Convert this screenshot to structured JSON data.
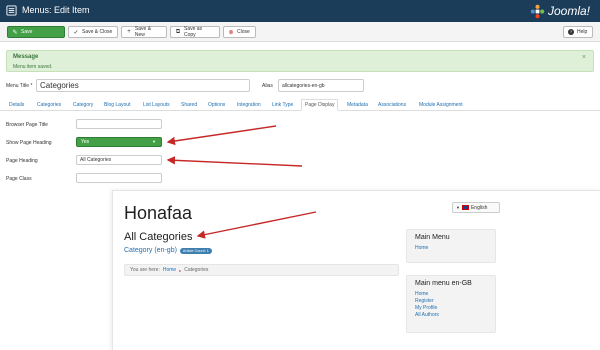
{
  "header": {
    "title": "Menus: Edit Item",
    "brand": "Joomla!"
  },
  "toolbar": {
    "save": "Save",
    "save_close": "Save & Close",
    "save_new": "Save & New",
    "save_copy": "Save as Copy",
    "close": "Close",
    "help": "Help"
  },
  "message": {
    "heading": "Message",
    "body": "Menu item saved.",
    "close": "×"
  },
  "form": {
    "menu_title_label": "Menu Title *",
    "menu_title_value": "Categories",
    "alias_label": "Alias",
    "alias_value": "allcategories-en-gb"
  },
  "tabs": [
    "Details",
    "Categories",
    "Category",
    "Blog Layout",
    "List Layouts",
    "Shared",
    "Options",
    "Integration",
    "Link Type",
    "Page Display",
    "Metadata",
    "Associations",
    "Module Assignment"
  ],
  "page_display": {
    "browser_title_label": "Browser Page Title",
    "browser_title_value": "",
    "show_heading_label": "Show Page Heading",
    "show_heading_value": "Yes",
    "page_heading_label": "Page Heading",
    "page_heading_value": "All Categories",
    "page_class_label": "Page Class",
    "page_class_value": ""
  },
  "preview": {
    "site_name": "Honafaa",
    "language": "English",
    "page_heading": "All Categories",
    "category": "Category (en-gb)",
    "article_count": "Article Count: 1",
    "breadcrumb_prefix": "You are here:",
    "breadcrumb_home": "Home",
    "breadcrumb_current": "Categories",
    "main_menu_title": "Main Menu",
    "main_menu_items": [
      "Home"
    ],
    "menu_en_title": "Main menu en-GB",
    "menu_en_items": [
      "Home",
      "Register",
      "My Profile",
      "All Authors"
    ]
  },
  "colors": {
    "header": "#1c3d5a",
    "save": "#43a047",
    "arrow": "#c62828",
    "link": "#1f6fb2"
  }
}
